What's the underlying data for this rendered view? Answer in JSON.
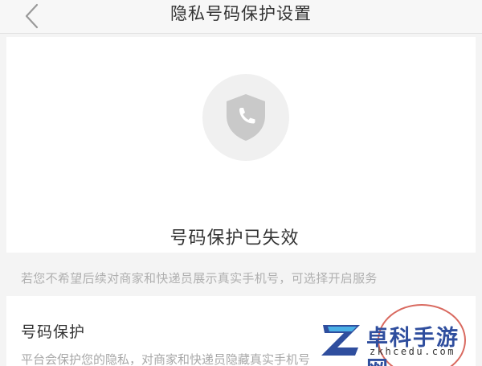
{
  "header": {
    "title": "隐私号码保护设置"
  },
  "status": {
    "icon": "shield-phone-icon",
    "text": "号码保护已失效"
  },
  "hint": {
    "text": "若您不希望后续对商家和快递员展示真实手机号，可选择开启服务"
  },
  "setting": {
    "title": "号码保护",
    "description": "平台会保护您的隐私，对商家和快递员隐藏真实手机号"
  },
  "watermark": {
    "name": "卓科手游网",
    "domain": "zkhcedu.com"
  },
  "colors": {
    "accent_ring": "#d96a60",
    "watermark_blue": "#2f4e9e"
  }
}
